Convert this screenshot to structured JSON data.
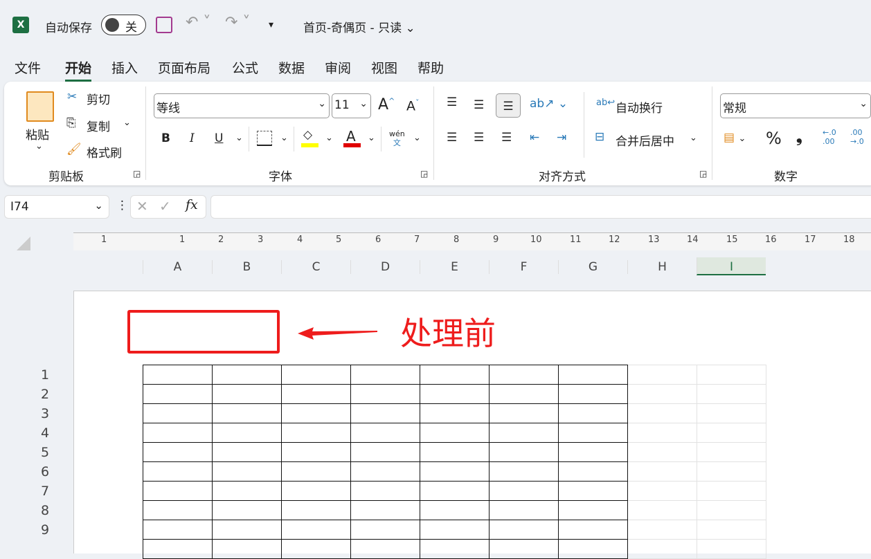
{
  "titlebar": {
    "autosave": "自动保存",
    "toggle": "关",
    "doc_title": "首页-奇偶页  -  只读"
  },
  "tabs": [
    "文件",
    "开始",
    "插入",
    "页面布局",
    "公式",
    "数据",
    "审阅",
    "视图",
    "帮助"
  ],
  "clipboard": {
    "paste": "粘贴",
    "cut": "剪切",
    "copy": "复制",
    "format_painter": "格式刷",
    "group": "剪贴板"
  },
  "font": {
    "name": "等线",
    "size": "11",
    "bold": "B",
    "italic": "I",
    "underline": "U",
    "phonetic_top": "wén",
    "phonetic_bottom": "文",
    "grow": "A",
    "shrink": "A",
    "color": "A",
    "group": "字体",
    "fill_color": "#ffff00",
    "font_color": "#e00000"
  },
  "alignment": {
    "wrap": "自动换行",
    "merge": "合并后居中",
    "group": "对齐方式"
  },
  "number": {
    "format": "常规",
    "percent": "%",
    "comma": "❟",
    "group": "数字",
    "inc": "←.0 .00",
    "dec": ".00 →.0"
  },
  "formula": {
    "name_box": "I74",
    "fx": "fx",
    "value": ""
  },
  "ruler": [
    "1",
    "1",
    "2",
    "3",
    "4",
    "5",
    "6",
    "7",
    "8",
    "9",
    "10",
    "11",
    "12",
    "13",
    "14",
    "15",
    "16",
    "17",
    "18"
  ],
  "columns": [
    "A",
    "B",
    "C",
    "D",
    "E",
    "F",
    "G",
    "H",
    "I"
  ],
  "rows": [
    "1",
    "2",
    "3",
    "4",
    "5",
    "6",
    "7",
    "8",
    "9"
  ],
  "annotation": {
    "text": "处理前",
    "color": "#ee1c1c"
  }
}
